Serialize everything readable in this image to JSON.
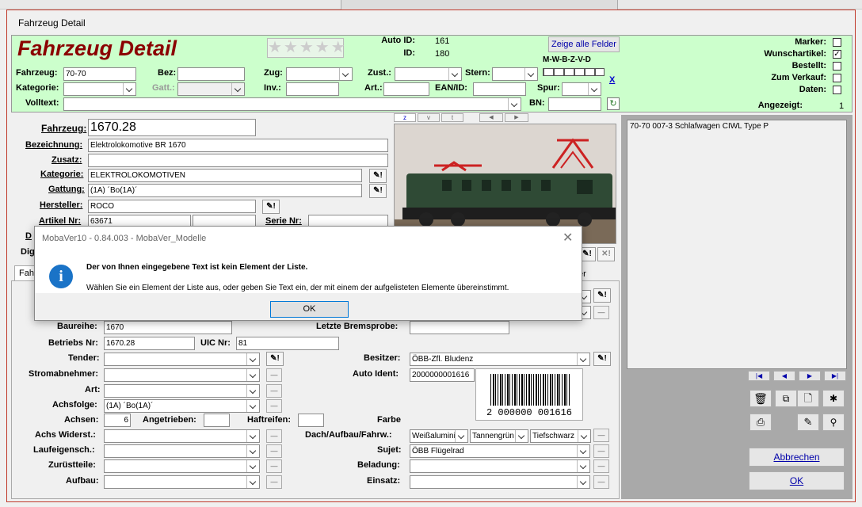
{
  "window": {
    "title": "Fahrzeug Detail"
  },
  "header": {
    "title": "Fahrzeug Detail",
    "stars": "★★★★★",
    "auto_id_label": "Auto ID:",
    "auto_id": "161",
    "id_label": "ID:",
    "id": "180",
    "show_all_button": "Zeige alle Felder",
    "mwbzvd": "M-W-B-Z-V-D",
    "close_x": "X",
    "angezeigt_label": "Angezeigt:",
    "angezeigt": "1"
  },
  "filters": {
    "fahrzeug_label": "Fahrzeug:",
    "fahrzeug_value": "70-70",
    "bez_label": "Bez:",
    "zug_label": "Zug:",
    "zust_label": "Zust.:",
    "stern_label": "Stern:",
    "kategorie_label": "Kategorie:",
    "gatt_label": "Gatt.:",
    "inv_label": "Inv.:",
    "art_label": "Art.:",
    "ean_label": "EAN/ID:",
    "spur_label": "Spur:",
    "volltext_label": "Volltext:",
    "bn_label": "BN:"
  },
  "flags": {
    "marker": "Marker:",
    "wunsch": "Wunschartikel:",
    "bestellt": "Bestellt:",
    "verkauf": "Zum Verkauf:",
    "daten": "Daten:",
    "wunsch_check": "✓"
  },
  "detail": {
    "fahrzeug_label": "Fahrzeug:",
    "fahrzeug": "1670.28",
    "bezeichnung_label": "Bezeichnung:",
    "bezeichnung": "Elektrolokomotive BR 1670",
    "zusatz_label": "Zusatz:",
    "kategorie_label": "Kategorie:",
    "kategorie": "ELEKTROLOKOMOTIVEN",
    "gattung_label": "Gattung:",
    "gattung": "(1A) ´Bo(1A)´",
    "hersteller_label": "Hersteller:",
    "hersteller": "ROCO",
    "artikel_label": "Artikel Nr:",
    "artikel": "63671",
    "serie_label": "Serie Nr:",
    "d_label": "D",
    "dig_label": "Dig",
    "tab_label": "Fahr",
    "tab_right": "er"
  },
  "list": {
    "items": [
      "70-70 007-3 Schlafwagen CIWL Type P"
    ]
  },
  "tech": {
    "baureihe_label": "Baureihe:",
    "baureihe": "1670",
    "bremsprobe_label": "Letzte Bremsprobe:",
    "betriebs_label": "Betriebs Nr:",
    "betriebs": "1670.28",
    "uic_label": "UIC Nr:",
    "uic": "81",
    "tender_label": "Tender:",
    "besitzer_label": "Besitzer:",
    "besitzer": "ÖBB-Zfl. Bludenz",
    "strom_label": "Stromabnehmer:",
    "autoident_label": "Auto Ident:",
    "autoident": "2000000001616",
    "art_label": "Art:",
    "achsfolge_label": "Achsfolge:",
    "achsfolge": "(1A) ´Bo(1A)´",
    "achsen_label": "Achsen:",
    "achsen": "6",
    "angetrieben_label": "Angetrieben:",
    "haftreifen_label": "Haftreifen:",
    "farbe_label": "Farbe",
    "achswid_label": "Achs Widerst.:",
    "dach_label": "Dach/Aufbau/Fahrw.:",
    "dach": "Weißalumini",
    "aufbau": "Tannengrün",
    "fahrw": "Tiefschwarz",
    "lauf_label": "Laufeigensch.:",
    "sujet_label": "Sujet:",
    "sujet": "ÖBB Flügelrad",
    "zuruest_label": "Zurüstteile:",
    "beladung_label": "Beladung:",
    "aufbau_label": "Aufbau:",
    "einsatz_label": "Einsatz:",
    "barcode_text": "2 000000 001616"
  },
  "nav": {
    "first": "|◀",
    "prev": "◀",
    "next": "▶",
    "last": "▶|"
  },
  "buttons": {
    "abbrechen": "Abbrechen",
    "ok": "OK"
  },
  "photo_tabs": {
    "z": "z",
    "v": "v",
    "t": "t",
    "left": "◀",
    "right": "▶"
  },
  "dialog": {
    "title": "MobaVer10 - 0.84.003 - MobaVer_Modelle",
    "heading": "Der von Ihnen eingegebene Text ist kein Element der Liste.",
    "message": "Wählen Sie ein Element der Liste aus, oder geben Sie Text ein, der mit einem der aufgelisteten Elemente übereinstimmt.",
    "ok": "OK",
    "info_icon": "i"
  },
  "colors": {
    "header_bg": "#ccffcc",
    "title": "#8b0000",
    "border": "#c0392b"
  }
}
